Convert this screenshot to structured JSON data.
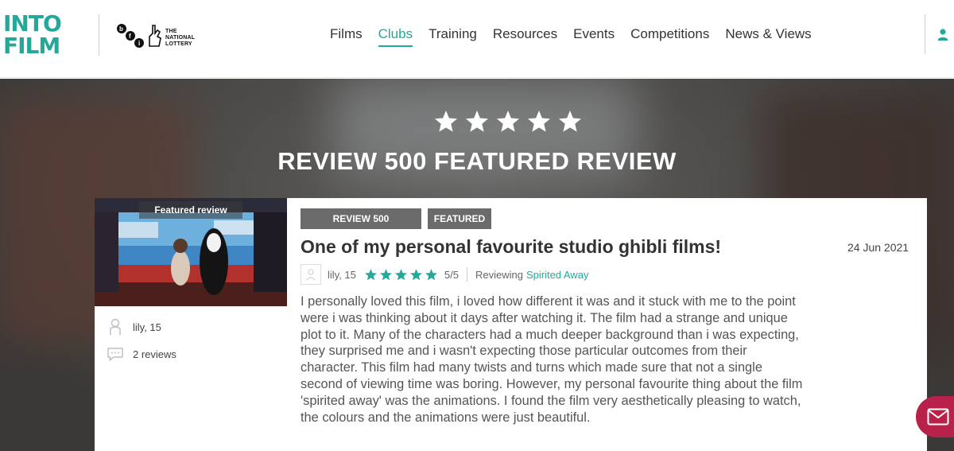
{
  "header": {
    "logo_line1": "INTO",
    "logo_line2": "FILM",
    "partner_text_1": "THE",
    "partner_text_2": "NATIONAL",
    "partner_text_3": "LOTTERY",
    "nav": [
      {
        "label": "Films"
      },
      {
        "label": "Clubs",
        "active": true
      },
      {
        "label": "Training"
      },
      {
        "label": "Resources"
      },
      {
        "label": "Events"
      },
      {
        "label": "Competitions"
      },
      {
        "label": "News & Views"
      }
    ]
  },
  "hero": {
    "rating_stars": 5,
    "title": "REVIEW 500 FEATURED REVIEW"
  },
  "sidebar_card": {
    "image_tag": "Featured review",
    "author": "lily, 15",
    "reviews_count": "2 reviews"
  },
  "review": {
    "badges": [
      "REVIEW 500",
      "FEATURED"
    ],
    "title": "One of my personal favourite studio ghibli films!",
    "date": "24 Jun 2021",
    "author": "lily, 15",
    "rating_stars": 5,
    "rating_text": "5/5",
    "reviewing_label": "Reviewing",
    "film": "Spirited Away",
    "body": "I personally loved this film, i loved how different it was and it stuck with me to the point were i was thinking about it days after watching it. The film had a strange and unique plot to it. Many of the characters had a much deeper background than i was expecting, they surprised me and i wasn't expecting those particular outcomes from their character. This film had many twists and turns which made sure that not a single second of viewing time was boring. However, my personal favourite thing about the film 'spirited away' was the animations. I found the film very aesthetically pleasing to watch, the colours and the animations were just beautiful."
  },
  "colors": {
    "accent": "#22a99a",
    "star_green": "#22a99a",
    "badge_grey": "#6b6b6b",
    "message_button": "#b8224a"
  },
  "icons": [
    "user-icon",
    "star-icon",
    "person-icon",
    "speech-bubble-icon",
    "envelope-icon"
  ]
}
